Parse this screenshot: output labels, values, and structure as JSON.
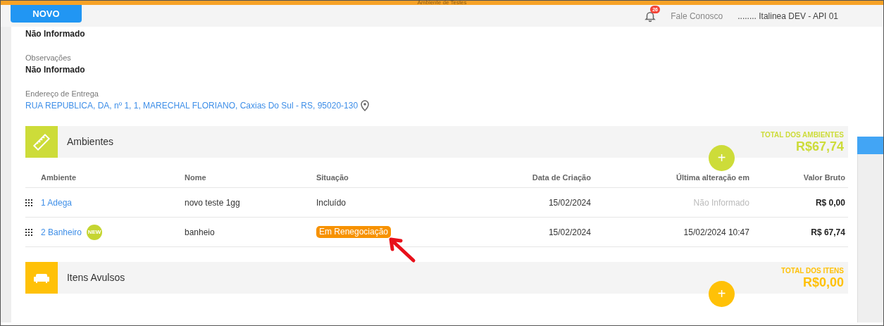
{
  "environment_label": "Ambiente de Testes",
  "header": {
    "new_button": "NOVO",
    "notification_count": "26",
    "contact_link": "Fale Conosco",
    "user": "........ Italinea DEV - API 01"
  },
  "fields": [
    {
      "value": "Não Informado",
      "kind": "text"
    },
    {
      "label": "Observações",
      "value": "Não Informado",
      "kind": "text"
    },
    {
      "label": "Endereço de Entrega",
      "value": "RUA REPUBLICA, DA, nº 1, 1, MARECHAL FLORIANO, Caxias Do Sul - RS, 95020-130",
      "kind": "address"
    }
  ],
  "ambientes": {
    "title": "Ambientes",
    "add_label": "+",
    "total_label": "TOTAL DOS AMBIENTES",
    "total_value": "R$67,74",
    "columns": [
      "Ambiente",
      "Nome",
      "Situação",
      "Data de Criação",
      "Última alteração em",
      "Valor Bruto"
    ],
    "rows": [
      {
        "ambiente": "1 Adega",
        "new": false,
        "nome": "novo teste 1gg",
        "situacao": "Incluído",
        "situacao_highlighted": false,
        "data_criacao": "15/02/2024",
        "ultima_alteracao": "Não Informado",
        "ultima_informed": false,
        "valor": "R$ 0,00"
      },
      {
        "ambiente": "2 Banheiro",
        "new": true,
        "new_label": "NEW",
        "nome": "banheio",
        "situacao": "Em Renegociação",
        "situacao_highlighted": true,
        "data_criacao": "15/02/2024",
        "ultima_alteracao": "15/02/2024 10:47",
        "ultima_informed": true,
        "valor": "R$ 67,74"
      }
    ]
  },
  "itens": {
    "title": "Itens Avulsos",
    "add_label": "+",
    "total_label": "TOTAL DOS ITENS",
    "total_value": "R$0,00"
  }
}
